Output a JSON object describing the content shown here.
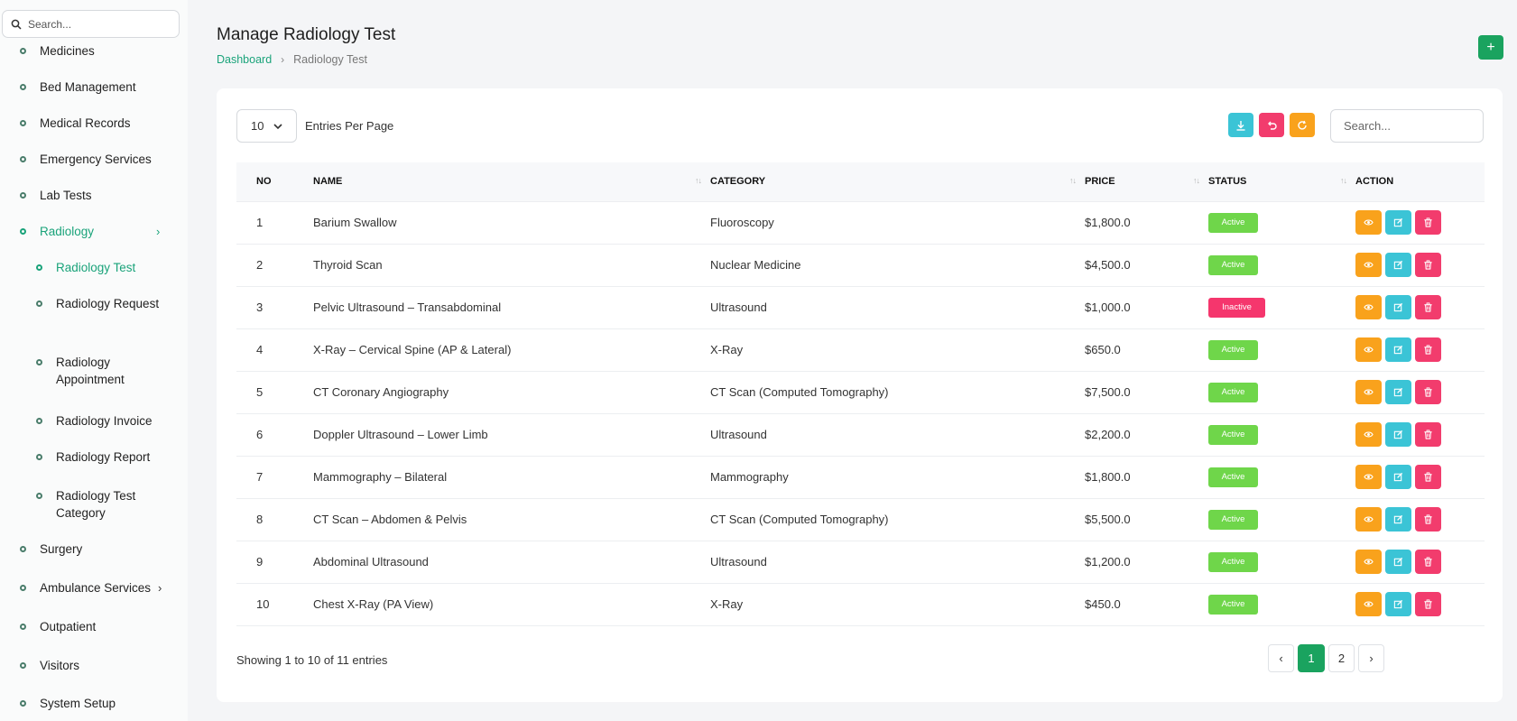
{
  "sidebar": {
    "search_placeholder": "Search...",
    "items": [
      {
        "label": "Medicines"
      },
      {
        "label": "Bed Management"
      },
      {
        "label": "Medical Records"
      },
      {
        "label": "Emergency Services"
      },
      {
        "label": "Lab Tests"
      },
      {
        "label": "Radiology"
      },
      {
        "label": "Radiology Test"
      },
      {
        "label": "Radiology Request"
      },
      {
        "label": "Radiology Appointment"
      },
      {
        "label": "Radiology Invoice"
      },
      {
        "label": "Radiology Report"
      },
      {
        "label": "Radiology Test Category"
      },
      {
        "label": "Surgery"
      },
      {
        "label": "Ambulance Services"
      },
      {
        "label": "Outpatient"
      },
      {
        "label": "Visitors"
      },
      {
        "label": "System Setup"
      }
    ]
  },
  "header": {
    "title": "Manage Radiology Test",
    "breadcrumb": [
      "Dashboard",
      "Radiology Test"
    ],
    "add_button": "+"
  },
  "toolbar": {
    "entries_value": "10",
    "entries_label": "Entries Per Page",
    "search_placeholder": "Search..."
  },
  "table": {
    "columns": [
      "NO",
      "NAME",
      "CATEGORY",
      "PRICE",
      "STATUS",
      "ACTION"
    ],
    "rows": [
      {
        "no": "1",
        "name": "Barium Swallow",
        "category": "Fluoroscopy",
        "price": "$1,800.0",
        "status": "Active"
      },
      {
        "no": "2",
        "name": "Thyroid Scan",
        "category": "Nuclear Medicine",
        "price": "$4,500.0",
        "status": "Active"
      },
      {
        "no": "3",
        "name": "Pelvic Ultrasound – Transabdominal",
        "category": "Ultrasound",
        "price": "$1,000.0",
        "status": "Inactive"
      },
      {
        "no": "4",
        "name": "X-Ray – Cervical Spine (AP & Lateral)",
        "category": "X-Ray",
        "price": "$650.0",
        "status": "Active"
      },
      {
        "no": "5",
        "name": "CT Coronary Angiography",
        "category": "CT Scan (Computed Tomography)",
        "price": "$7,500.0",
        "status": "Active"
      },
      {
        "no": "6",
        "name": "Doppler Ultrasound – Lower Limb",
        "category": "Ultrasound",
        "price": "$2,200.0",
        "status": "Active"
      },
      {
        "no": "7",
        "name": "Mammography – Bilateral",
        "category": "Mammography",
        "price": "$1,800.0",
        "status": "Active"
      },
      {
        "no": "8",
        "name": "CT Scan – Abdomen & Pelvis",
        "category": "CT Scan (Computed Tomography)",
        "price": "$5,500.0",
        "status": "Active"
      },
      {
        "no": "9",
        "name": "Abdominal Ultrasound",
        "category": "Ultrasound",
        "price": "$1,200.0",
        "status": "Active"
      },
      {
        "no": "10",
        "name": "Chest X-Ray (PA View)",
        "category": "X-Ray",
        "price": "$450.0",
        "status": "Active"
      }
    ]
  },
  "footer": {
    "showing": "Showing 1 to 10 of 11 entries",
    "pages": [
      "1",
      "2"
    ],
    "prev": "‹",
    "next": "›"
  },
  "colors": {
    "primary_green": "#1aa35f",
    "active_badge": "#6fd64a",
    "inactive_badge": "#f5366d",
    "view_button": "#f9a21c",
    "edit_button": "#3bc4d6",
    "delete_button": "#f23c6d",
    "export_button": "#3bc4d6",
    "reset_button": "#f23c6d",
    "refresh_button": "#f9a21c"
  },
  "icons": {
    "sidebar_search": "search-icon",
    "export": "download-icon",
    "reset": "undo-icon",
    "refresh": "refresh-icon",
    "view": "eye-icon",
    "edit": "edit-icon",
    "delete": "trash-icon"
  }
}
